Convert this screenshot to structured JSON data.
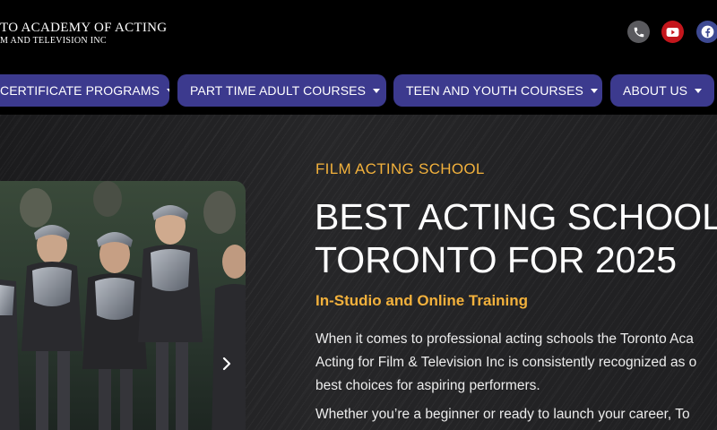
{
  "header": {
    "logo_line1": "TO ACADEMY OF ACTING",
    "logo_line2": "M AND TELEVISION INC",
    "social": [
      {
        "name": "phone-icon",
        "color": "#5a5a5e"
      },
      {
        "name": "youtube-icon",
        "color": "#c4161c"
      },
      {
        "name": "facebook-icon",
        "color": "#3e4a93"
      }
    ]
  },
  "nav": {
    "items": [
      {
        "label": "CERTIFICATE PROGRAMS"
      },
      {
        "label": "PART TIME ADULT COURSES"
      },
      {
        "label": "TEEN AND YOUTH COURSES"
      },
      {
        "label": "ABOUT US"
      }
    ],
    "accent": "#3c3a8e"
  },
  "hero": {
    "eyebrow": "FILM ACTING SCHOOL",
    "title_line1": "BEST ACTING SCHOOL",
    "title_line2": "TORONTO FOR 2025",
    "subtitle": "In-Studio and Online Training",
    "body_line1": "When it comes to professional acting schools the Toronto Aca",
    "body_line2": "Acting for Film & Television Inc is consistently recognized as o",
    "body_line3": "best choices for aspiring performers.",
    "body_line4": "Whether you’re a beginner or ready to launch your career, To",
    "accent_color": "#f2b13c",
    "slider_next_icon": "chevron-right-icon"
  }
}
